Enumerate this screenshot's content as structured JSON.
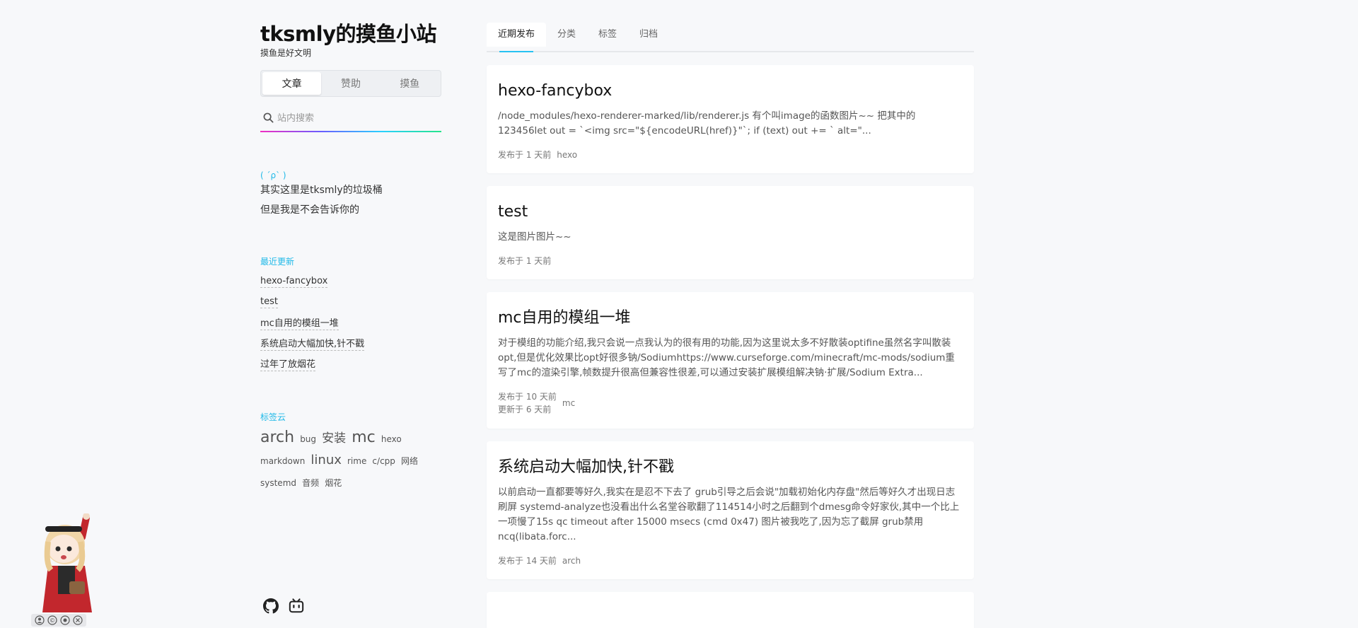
{
  "site": {
    "title": "tksmly的摸鱼小站",
    "subtitle": "摸鱼是好文明"
  },
  "segmented": {
    "items": [
      "文章",
      "赞助",
      "摸鱼"
    ],
    "active_index": 0
  },
  "search": {
    "placeholder": "站内搜索",
    "value": ""
  },
  "about": {
    "kaomoji": "( ´ρ` )",
    "lines": [
      "其实这里是tksmly的垃圾桶",
      "但是我是不会告诉你的"
    ]
  },
  "recent": {
    "title": "最近更新",
    "items": [
      "hexo-fancybox",
      "test",
      "mc自用的模组一堆",
      "系统启动大幅加快,针不戳",
      "过年了放烟花"
    ]
  },
  "tagcloud": {
    "title": "标签云",
    "tags": [
      {
        "name": "arch",
        "size": 22
      },
      {
        "name": "bug",
        "size": 12
      },
      {
        "name": "安装",
        "size": 17
      },
      {
        "name": "mc",
        "size": 22
      },
      {
        "name": "hexo",
        "size": 12
      },
      {
        "name": "markdown",
        "size": 12
      },
      {
        "name": "linux",
        "size": 18
      },
      {
        "name": "rime",
        "size": 12
      },
      {
        "name": "c/cpp",
        "size": 12
      },
      {
        "name": "网络",
        "size": 12
      },
      {
        "name": "systemd",
        "size": 12
      },
      {
        "name": "音频",
        "size": 12
      },
      {
        "name": "烟花",
        "size": 12
      }
    ]
  },
  "tabs": {
    "items": [
      "近期发布",
      "分类",
      "标签",
      "归档"
    ],
    "active_index": 0
  },
  "posts": [
    {
      "title": "hexo-fancybox",
      "excerpt": "/node_modules/hexo-renderer-marked/lib/renderer.js 有个叫image的函数图片~~ 把其中的123456let out = `<img src=\"${encodeURL(href)}\"`; if (text) out += ` alt=\"...",
      "published": "发布于 1 天前",
      "updated": "",
      "tag": "hexo"
    },
    {
      "title": "test",
      "excerpt": "这是图片图片~~",
      "published": "发布于 1 天前",
      "updated": "",
      "tag": ""
    },
    {
      "title": "mc自用的模组一堆",
      "excerpt": "对于模组的功能介绍,我只会说一点我认为的很有用的功能,因为这里说太多不好散装optifine虽然名字叫散装opt,但是优化效果比opt好很多钠/Sodiumhttps://www.curseforge.com/minecraft/mc-mods/sodium重写了mc的渲染引擎,帧数提升很高但兼容性很差,可以通过安装扩展模组解决钠·扩展/Sodium Extra...",
      "published": "发布于 10 天前",
      "updated": "更新于 6 天前",
      "tag": "mc"
    },
    {
      "title": "系统启动大幅加快,针不戳",
      "excerpt": "以前启动一直都要等好久,我实在是忍不下去了 grub引导之后会说\"加载初始化内存盘\"然后等好久才出现日志刷屏 systemd-analyze也没看出什么名堂谷歌翻了114514小时之后翻到个dmesg命令好家伙,其中一个比上一项慢了15s qc timeout after 15000 msecs (cmd 0x47) 图片被我吃了,因为忘了截屏 grub禁用ncq(libata.forc...",
      "published": "发布于 14 天前",
      "updated": "",
      "tag": "arch"
    }
  ],
  "social": {
    "icons": [
      "github-icon",
      "bilibili-icon"
    ]
  },
  "colors": {
    "accent": "#1fb9e8",
    "background": "#f7f8fa",
    "card": "#ffffff"
  }
}
